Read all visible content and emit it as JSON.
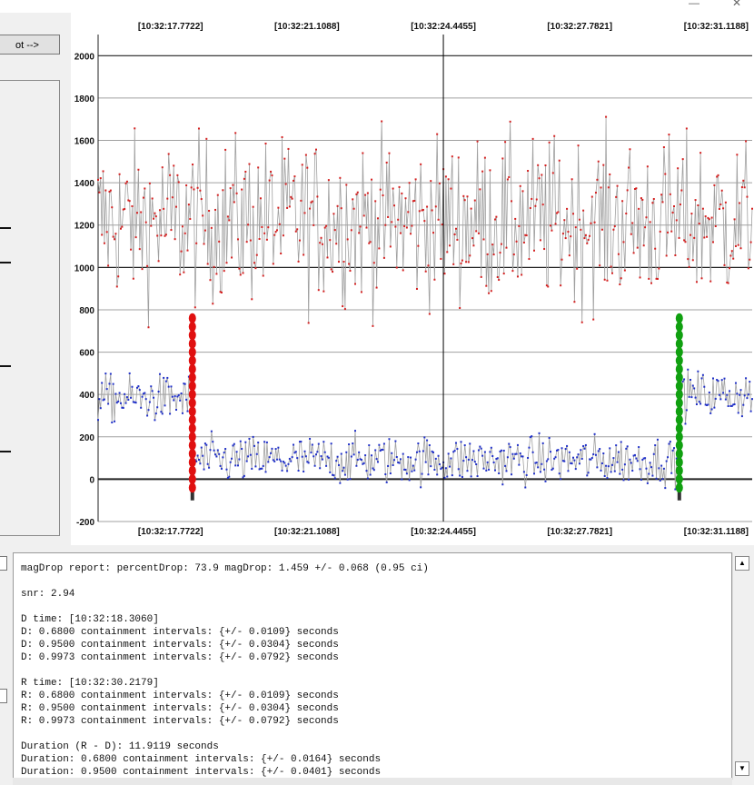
{
  "plot_button_label": "ot -->",
  "titlebar": {
    "minimize_glyph": "—",
    "close_glyph": "✕"
  },
  "chart_data": {
    "type": "scatter",
    "title": "",
    "xlabel": "",
    "ylabel": "",
    "ylim": [
      -200,
      2100
    ],
    "yticks": [
      2000,
      1800,
      1600,
      1400,
      1200,
      1000,
      800,
      600,
      400,
      200,
      0,
      -200
    ],
    "xticks": [
      "[10:32:17.7722]",
      "[10:32:21.1088]",
      "[10:32:24.4455]",
      "[10:32:27.7821]",
      "[10:32:31.1188]"
    ],
    "xlim_seconds": [
      16.0,
      32.0
    ],
    "xtick_seconds": [
      17.7722,
      21.1088,
      24.4455,
      27.7821,
      31.1188
    ],
    "cursor_time_seconds": 24.4455,
    "series": [
      {
        "role": "comparison",
        "color": "#d42020",
        "mean": 1220,
        "spread": 190
      },
      {
        "role": "target",
        "color": "#2030c8",
        "baseline_before": 380,
        "baseline_during": 90,
        "baseline_after": 400,
        "spread": 55
      }
    ],
    "d_edge": {
      "time_seconds": 18.306,
      "color": "#e01010",
      "y_top": 780,
      "y_bottom": -100
    },
    "r_edge": {
      "time_seconds": 30.2179,
      "color": "#10a010",
      "y_top": 780,
      "y_bottom": -100
    },
    "colors": {
      "grid": "#a0a0a0",
      "zero_line": "#000000",
      "edge_bar": "#333333",
      "connector": "#a0a0a0"
    }
  },
  "report_lines": [
    "magDrop report: percentDrop: 73.9 magDrop: 1.459 +/- 0.068 (0.95 ci)",
    "",
    "snr: 2.94",
    "",
    "D time: [10:32:18.3060]",
    "D: 0.6800 containment intervals: {+/- 0.0109} seconds",
    "D: 0.9500 containment intervals: {+/- 0.0304} seconds",
    "D: 0.9973 containment intervals: {+/- 0.0792} seconds",
    "",
    "R time: [10:32:30.2179]",
    "R: 0.6800 containment intervals: {+/- 0.0109} seconds",
    "R: 0.9500 containment intervals: {+/- 0.0304} seconds",
    "R: 0.9973 containment intervals: {+/- 0.0792} seconds",
    "",
    "Duration (R - D): 11.9119 seconds",
    "Duration: 0.6800 containment intervals: {+/- 0.0164} seconds",
    "Duration: 0.9500 containment intervals: {+/- 0.0401} seconds"
  ],
  "scroll": {
    "up_glyph": "▲",
    "down_glyph": "▼"
  }
}
